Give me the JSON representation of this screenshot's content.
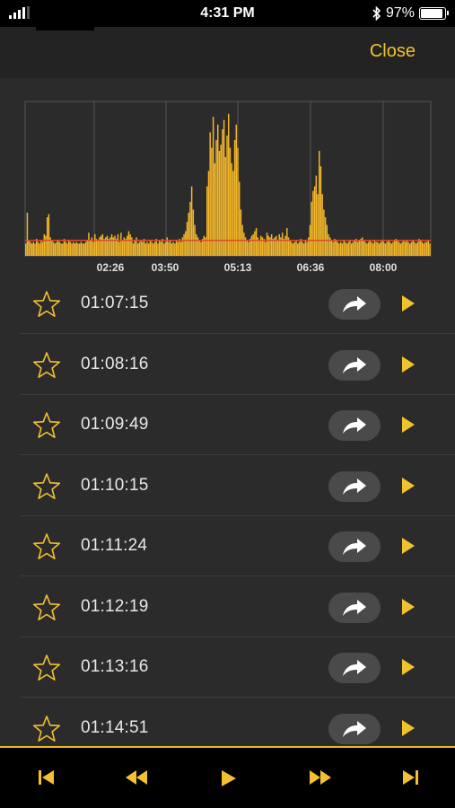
{
  "status_bar": {
    "time": "4:31 PM",
    "battery_text": "97%",
    "battery_level": 0.97,
    "icons": [
      "signal-icon",
      "bluetooth-icon",
      "battery-icon"
    ]
  },
  "nav": {
    "close_label": "Close"
  },
  "colors": {
    "accent": "#f2c12e",
    "bars": "#f5b82a",
    "threshold": "#e04a2a",
    "grid": "#555555",
    "background": "#2b2b2b"
  },
  "chart_data": {
    "type": "bar",
    "tick_labels": [
      "02:26",
      "03:50",
      "05:13",
      "06:36",
      "08:00"
    ],
    "ylim": [
      0,
      100
    ],
    "threshold": 10,
    "grid": true,
    "values": [
      8,
      28,
      10,
      9,
      8,
      9,
      8,
      11,
      9,
      8,
      10,
      9,
      14,
      13,
      25,
      27,
      12,
      10,
      9,
      8,
      9,
      10,
      9,
      8,
      8,
      11,
      9,
      8,
      10,
      9,
      8,
      9,
      8,
      9,
      8,
      8,
      9,
      8,
      8,
      9,
      10,
      15,
      10,
      12,
      9,
      14,
      11,
      10,
      12,
      13,
      14,
      11,
      12,
      13,
      11,
      12,
      14,
      12,
      13,
      11,
      14,
      9,
      15,
      10,
      12,
      11,
      13,
      16,
      14,
      12,
      8,
      10,
      12,
      8,
      9,
      10,
      9,
      11,
      8,
      9,
      8,
      10,
      9,
      8,
      9,
      11,
      8,
      10,
      9,
      11,
      8,
      9,
      12,
      9,
      10,
      8,
      9,
      8,
      10,
      9,
      11,
      9,
      12,
      14,
      16,
      22,
      28,
      35,
      45,
      30,
      20,
      14,
      12,
      10,
      9,
      11,
      13,
      12,
      45,
      55,
      80,
      70,
      90,
      60,
      75,
      85,
      68,
      72,
      82,
      88,
      64,
      78,
      92,
      70,
      60,
      55,
      75,
      85,
      70,
      48,
      30,
      20,
      15,
      12,
      10,
      9,
      11,
      13,
      14,
      16,
      18,
      12,
      10,
      13,
      12,
      11,
      9,
      15,
      13,
      12,
      14,
      11,
      12,
      13,
      10,
      14,
      12,
      15,
      11,
      13,
      18,
      12,
      10,
      9,
      8,
      9,
      10,
      8,
      9,
      11,
      9,
      8,
      10,
      9,
      12,
      20,
      35,
      42,
      45,
      52,
      40,
      68,
      58,
      40,
      30,
      25,
      20,
      14,
      12,
      10,
      9,
      11,
      10,
      9,
      8,
      9,
      8,
      10,
      9,
      8,
      9,
      10,
      8,
      9,
      10,
      11,
      9,
      10,
      11,
      12,
      10,
      9,
      8,
      9,
      10,
      9,
      8,
      10,
      9,
      9,
      8,
      9,
      10,
      9,
      8,
      9,
      10,
      9,
      8,
      9,
      10,
      11,
      10,
      9,
      8,
      9,
      10,
      9,
      10,
      9,
      8,
      9,
      10,
      9,
      8,
      9,
      11,
      10,
      9,
      8,
      9,
      9,
      10,
      8
    ]
  },
  "list": {
    "items": [
      {
        "time": "01:07:15"
      },
      {
        "time": "01:08:16"
      },
      {
        "time": "01:09:49"
      },
      {
        "time": "01:10:15"
      },
      {
        "time": "01:11:24"
      },
      {
        "time": "01:12:19"
      },
      {
        "time": "01:13:16"
      },
      {
        "time": "01:14:51"
      }
    ],
    "row_icons": [
      "star-icon",
      "share-icon",
      "play-icon"
    ]
  },
  "toolbar": {
    "buttons": [
      "skip-to-start-icon",
      "rewind-icon",
      "play-icon",
      "fast-forward-icon",
      "skip-to-end-icon"
    ]
  }
}
